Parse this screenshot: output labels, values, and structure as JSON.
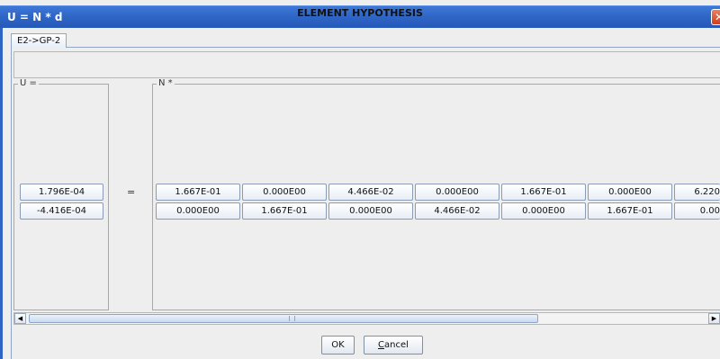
{
  "window": {
    "title": "U = N * d",
    "close_symbol": "✕"
  },
  "tab": {
    "label": "E2->GP-2"
  },
  "heading": "ELEMENT HYPOTHESIS",
  "groups": {
    "u_label": "U =",
    "n_label": "N *"
  },
  "equals": "=",
  "u_values": [
    "1.796E-04",
    "-4.416E-04"
  ],
  "n_rows": [
    [
      "1.667E-01",
      "0.000E00",
      "4.466E-02",
      "0.000E00",
      "1.667E-01",
      "0.000E00",
      "6.220"
    ],
    [
      "0.000E00",
      "1.667E-01",
      "0.000E00",
      "4.466E-02",
      "0.000E00",
      "1.667E-01",
      "0.00"
    ]
  ],
  "scrollbar": {
    "left_arrow": "◀",
    "right_arrow": "▶",
    "position_percent": 0
  },
  "buttons": {
    "ok": "OK",
    "cancel_first": "C",
    "cancel_rest": "ancel"
  }
}
